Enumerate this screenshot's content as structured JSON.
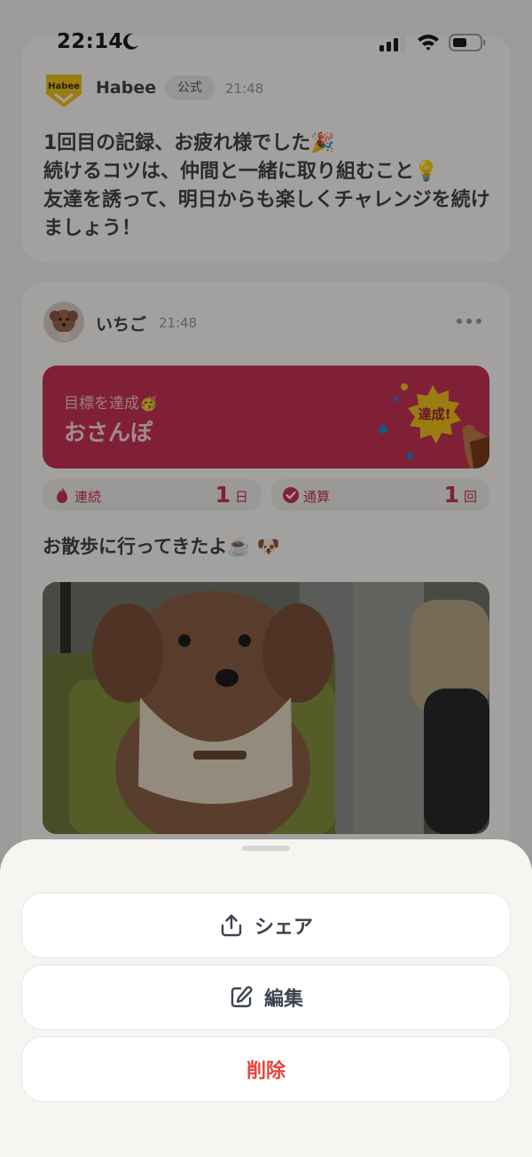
{
  "status_bar": {
    "time": "22:14"
  },
  "official_post": {
    "author": "Habee",
    "logo_text": "Habee",
    "badge": "公式",
    "time": "21:48",
    "text": "1回目の記録、お疲れ様でした🎉\n続けるコツは、仲間と一緒に取り組むこと💡\n友達を誘って、明日からも楽しくチャレンジを続けましょう！"
  },
  "user_post": {
    "author": "いちご",
    "time": "21:48",
    "goal": {
      "subtitle": "目標を達成🥳",
      "title": "おさんぽ",
      "badge": "達成!"
    },
    "stats": [
      {
        "label": "連続",
        "value": "1",
        "unit": "日"
      },
      {
        "label": "通算",
        "value": "1",
        "unit": "回"
      }
    ],
    "text": "お散歩に行ってきたよ☕️ 🐶"
  },
  "sheet": {
    "share_label": "シェア",
    "edit_label": "編集",
    "delete_label": "削除"
  },
  "colors": {
    "accent": "#c83257",
    "danger": "#e8443a",
    "sheet_bg": "#f6f5f2",
    "logo_yellow": "#f2c21b"
  }
}
